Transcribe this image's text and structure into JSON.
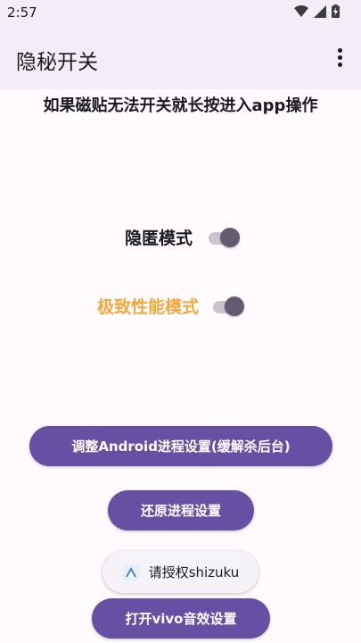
{
  "status_bar": {
    "time": "2:57",
    "icons": [
      "wifi-icon",
      "signal-icon",
      "battery-icon"
    ]
  },
  "app_bar": {
    "title": "隐秘开关",
    "menu_icon": "more-vert-icon"
  },
  "hint": "如果磁贴无法开关就长按进入app操作",
  "switches": [
    {
      "label": "隐匿模式",
      "color": "#1c1b1f",
      "checked": true
    },
    {
      "label": "极致性能模式",
      "color": "#f2a93b",
      "checked": true
    }
  ],
  "buttons": {
    "adjust_process": "调整Android进程设置(缓解杀后台)",
    "restore_process": "还原进程设置",
    "authorize_shizuku": "请授权shizuku",
    "open_vivo_audio": "打开vivo音效设置"
  },
  "colors": {
    "primary": "#6750a4",
    "surface": "#fffbfe",
    "app_bar": "#f3edf7",
    "accent_orange": "#f2a93b"
  }
}
